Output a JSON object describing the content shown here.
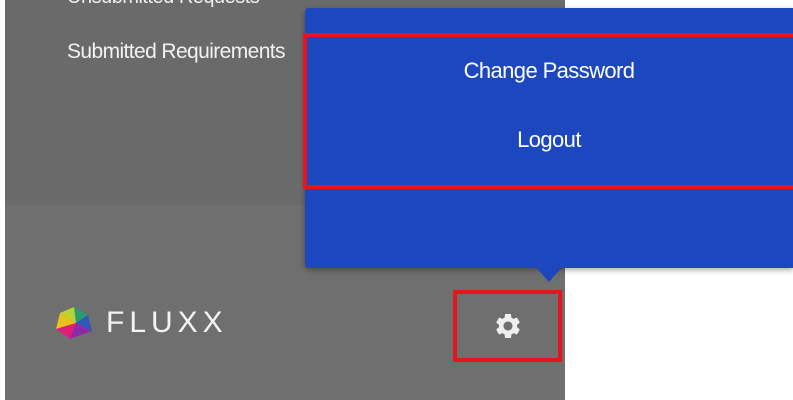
{
  "sidebar": {
    "partial_item": "Unsubmitted Requests",
    "active_item": "Submitted Requirements"
  },
  "logo": {
    "text": "FLUXX",
    "colors": [
      "#2a9d6f",
      "#b7d433",
      "#2f59b8",
      "#e21c79"
    ]
  },
  "settings": {
    "icon": "gear-icon"
  },
  "user_menu": {
    "items": [
      {
        "label": "Change Password"
      },
      {
        "label": "Logout"
      }
    ],
    "background": "#1c47be"
  },
  "highlight_color": "#e8141b"
}
